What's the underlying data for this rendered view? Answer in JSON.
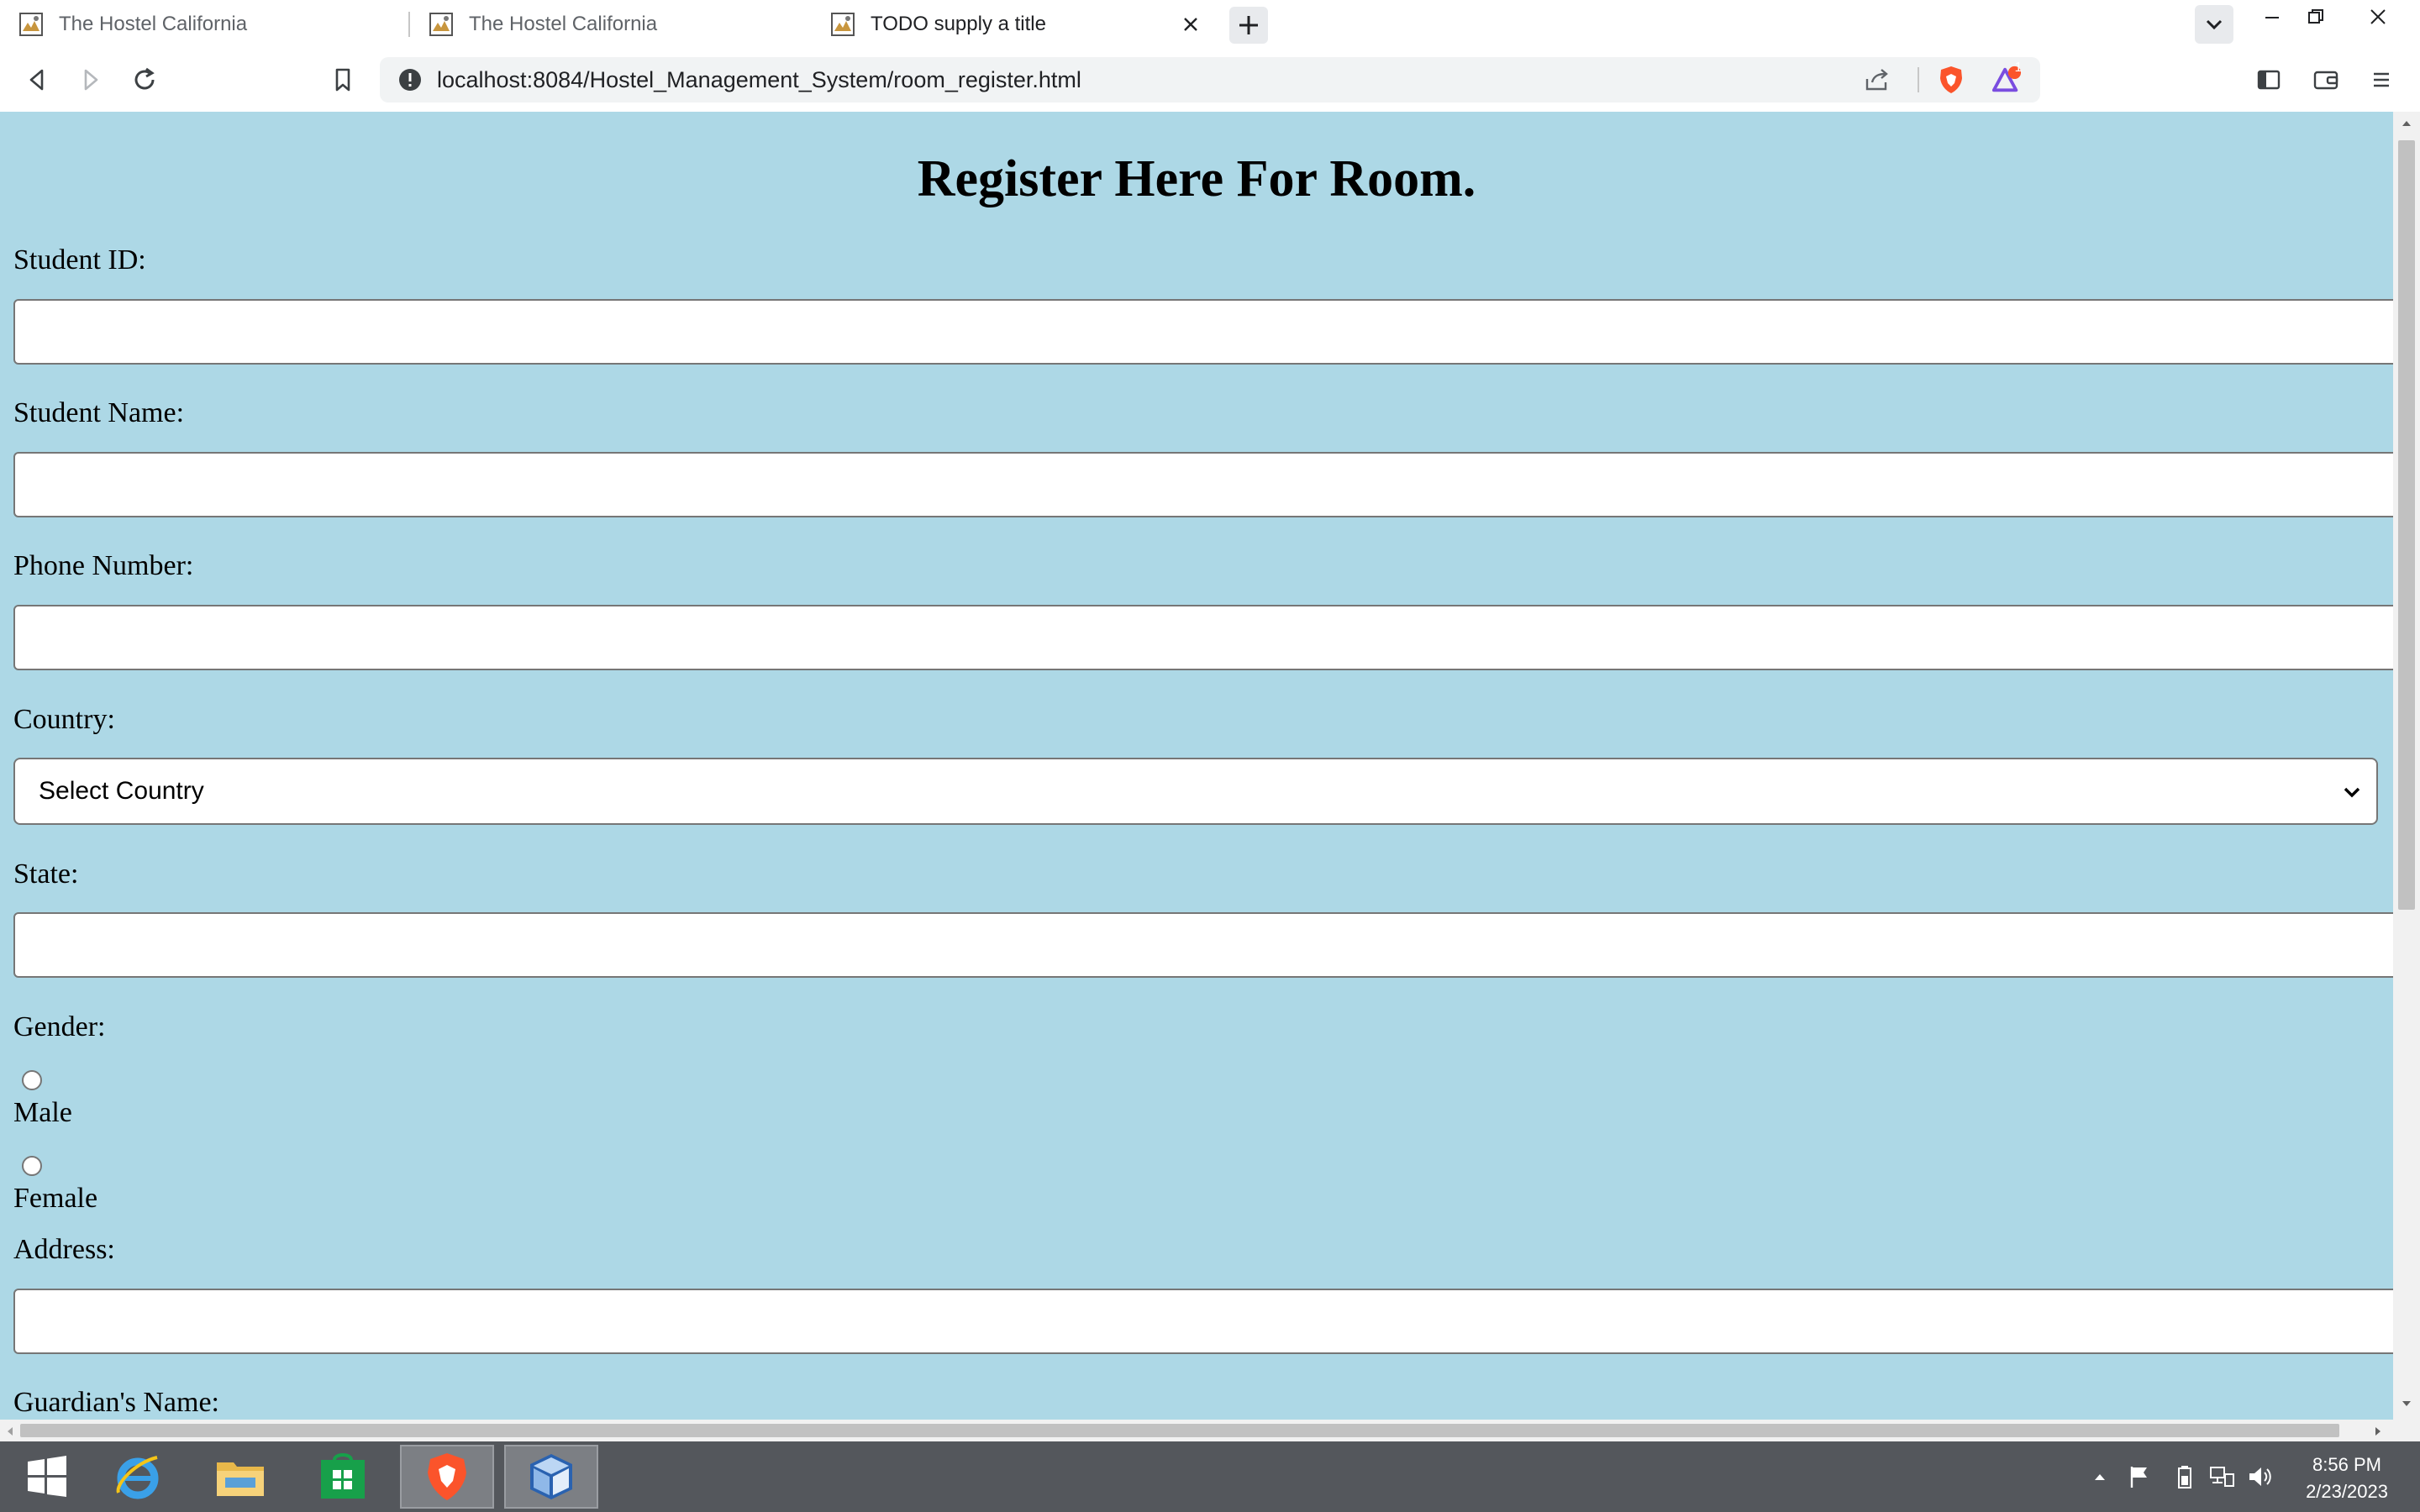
{
  "browser": {
    "tabs": [
      {
        "title": "The Hostel California",
        "active": false
      },
      {
        "title": "The Hostel California",
        "active": false
      },
      {
        "title": "TODO supply a title",
        "active": true
      }
    ],
    "url": "localhost:8084/Hostel_Management_System/room_register.html",
    "notification_count": "1"
  },
  "page": {
    "heading": "Register Here For Room.",
    "fields": {
      "student_id": {
        "label": "Student ID:",
        "value": ""
      },
      "student_name": {
        "label": "Student Name:",
        "value": ""
      },
      "phone": {
        "label": "Phone Number:",
        "value": ""
      },
      "country": {
        "label": "Country:",
        "selected": "Select Country"
      },
      "state": {
        "label": "State:",
        "value": ""
      },
      "gender": {
        "label": "Gender:",
        "options": [
          "Male",
          "Female"
        ]
      },
      "address": {
        "label": "Address:",
        "value": ""
      },
      "guardian": {
        "label": "Guardian's Name:"
      }
    }
  },
  "taskbar": {
    "apps": [
      "start",
      "internet-explorer",
      "file-explorer",
      "store",
      "brave",
      "virtualbox"
    ],
    "time": "8:56 PM",
    "date": "2/23/2023"
  },
  "colors": {
    "page_background": "#add8e6",
    "taskbar": "#54575c",
    "brave_orange": "#fb542b"
  }
}
